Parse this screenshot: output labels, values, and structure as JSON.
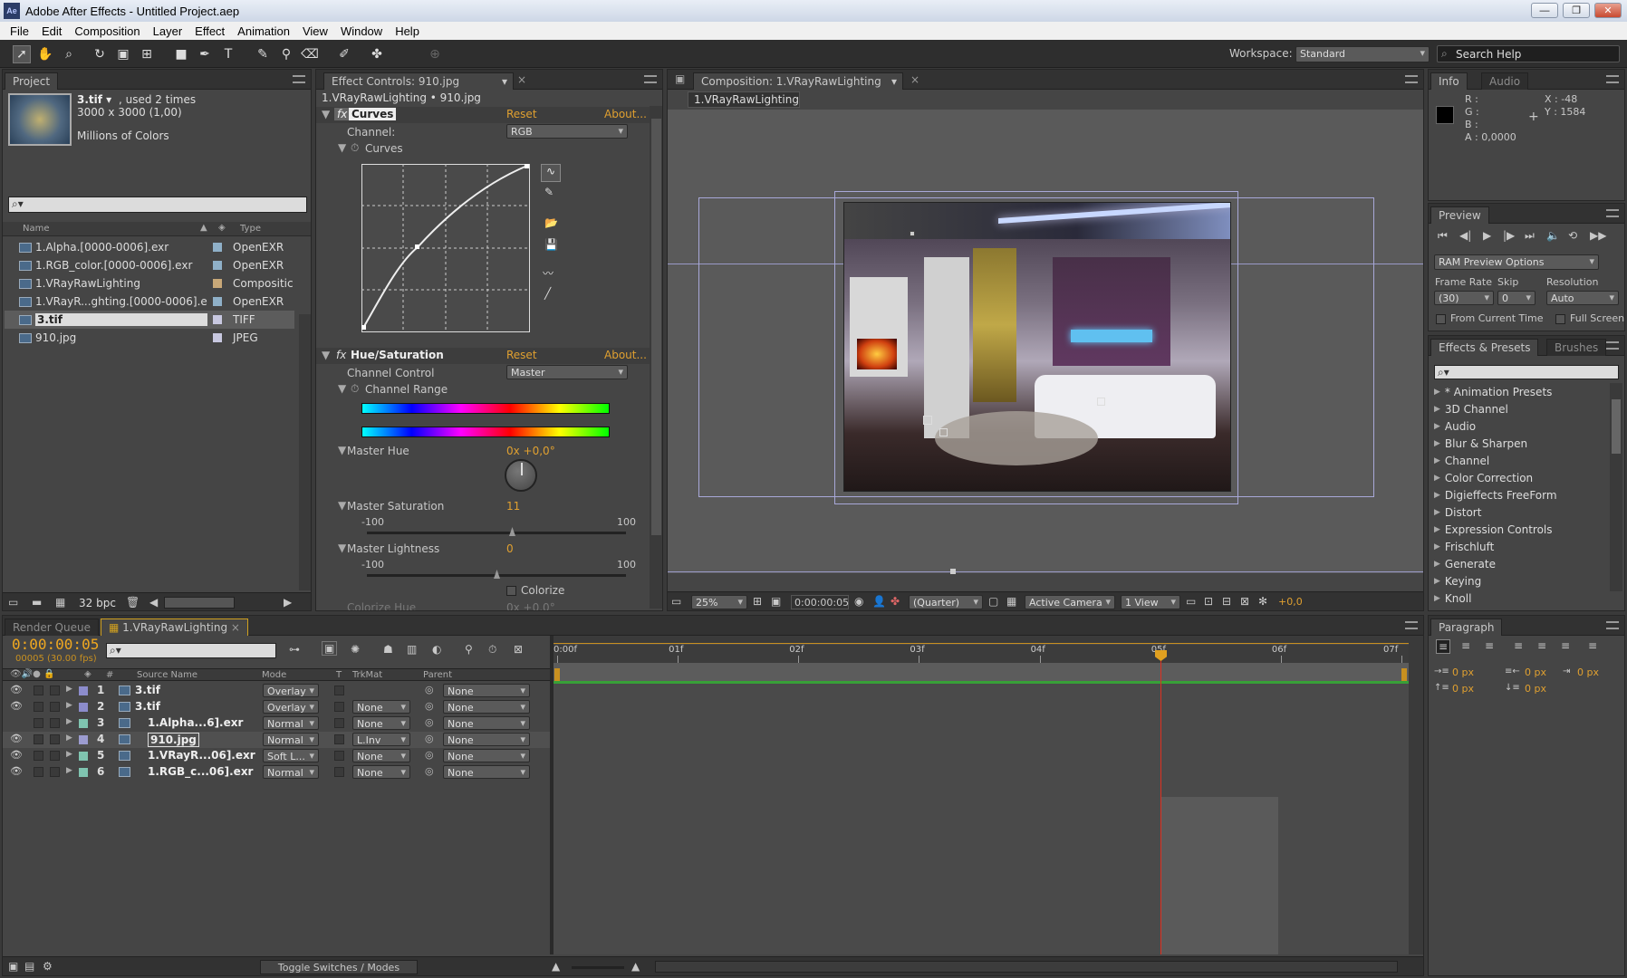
{
  "window": {
    "title": "Adobe After Effects - Untitled Project.aep",
    "icon": "Ae",
    "min": "—",
    "max": "❐",
    "close": "✕"
  },
  "menu": [
    "File",
    "Edit",
    "Composition",
    "Layer",
    "Effect",
    "Animation",
    "View",
    "Window",
    "Help"
  ],
  "toolbar": {
    "workspace_label": "Workspace:",
    "workspace_value": "Standard",
    "search_placeholder": "Search Help"
  },
  "project": {
    "tab": "Project",
    "item_name": "3.tif ▾",
    "item_used": ", used 2 times",
    "item_dims": "3000 x 3000 (1,00)",
    "item_colors": "Millions of Colors",
    "col_name": "Name",
    "col_type": "Type",
    "bpc": "32 bpc",
    "items": [
      {
        "name": "1.Alpha.[0000-0006].exr",
        "type": "OpenEXR",
        "color": "#8fb0c8"
      },
      {
        "name": "1.RGB_color.[0000-0006].exr",
        "type": "OpenEXR",
        "color": "#8fb0c8"
      },
      {
        "name": "1.VRayRawLighting",
        "type": "Compositic",
        "color": "#c8a878"
      },
      {
        "name": "1.VRayR...ghting.[0000-0006].exr",
        "type": "OpenEXR",
        "color": "#8fb0c8"
      },
      {
        "name": "3.tif",
        "type": "TIFF",
        "color": "#c8c8e0"
      },
      {
        "name": "910.jpg",
        "type": "JPEG",
        "color": "#c8c8e0"
      }
    ]
  },
  "effects": {
    "tab": "Effect Controls: 910.jpg",
    "subtitle": "1.VRayRawLighting • 910.jpg",
    "curves": {
      "name": "Curves",
      "reset": "Reset",
      "about": "About...",
      "channel_label": "Channel:",
      "channel_value": "RGB",
      "sub": "Curves"
    },
    "hue": {
      "name": "Hue/Saturation",
      "reset": "Reset",
      "about": "About...",
      "channel_control_label": "Channel Control",
      "channel_control_value": "Master",
      "channel_range": "Channel Range",
      "master_hue": "Master Hue",
      "master_hue_value": "0x +0,0°",
      "master_sat": "Master Saturation",
      "master_sat_value": "11",
      "master_sat_min": "-100",
      "master_sat_max": "100",
      "master_light": "Master Lightness",
      "master_light_value": "0",
      "master_light_min": "-100",
      "master_light_max": "100",
      "colorize": "Colorize",
      "colorize_hue": "Colorize Hue",
      "colorize_hue_value": "0x +0,0°"
    }
  },
  "comp": {
    "tab": "Composition: 1.VRayRawLighting",
    "subtab": "1.VRayRawLighting",
    "zoom": "25%",
    "timecode": "0:00:00:05",
    "resolution": "(Quarter)",
    "camera": "Active Camera",
    "view": "1 View",
    "exposure": "+0,0"
  },
  "info": {
    "tab": "Info",
    "tab2": "Audio",
    "r": "R :",
    "g": "G :",
    "b": "B :",
    "a": "A : 0,0000",
    "x": "X : -48",
    "y": "Y : 1584"
  },
  "preview": {
    "tab": "Preview",
    "ram": "RAM Preview Options",
    "frame_rate_label": "Frame Rate",
    "skip_label": "Skip",
    "resolution_label": "Resolution",
    "frame_rate": "(30)",
    "skip": "0",
    "resolution": "Auto",
    "from_current": "From Current Time",
    "full_screen": "Full Screen"
  },
  "fxpresets": {
    "tab": "Effects & Presets",
    "tab2": "Brushes",
    "items": [
      "* Animation Presets",
      "3D Channel",
      "Audio",
      "Blur & Sharpen",
      "Channel",
      "Color Correction",
      "Digieffects FreeForm",
      "Distort",
      "Expression Controls",
      "Frischluft",
      "Generate",
      "Keying",
      "Knoll"
    ]
  },
  "timeline": {
    "tab_render": "Render Queue",
    "tab_comp": "1.VRayRawLighting",
    "timecode": "0:00:00:05",
    "fps": "00005 (30.00 fps)",
    "headers": {
      "num": "#",
      "source": "Source Name",
      "mode": "Mode",
      "t": "T",
      "trkmat": "TrkMat",
      "parent": "Parent"
    },
    "ruler": [
      "0:00f",
      "01f",
      "02f",
      "03f",
      "04f",
      "05f",
      "06f",
      "07f"
    ],
    "toggle": "Toggle Switches / Modes",
    "layers": [
      {
        "num": "1",
        "name": "3.tif",
        "mode": "Overlay",
        "trkmat": "",
        "parent": "None",
        "color": "#8c8ccc",
        "bar": "#7878a8"
      },
      {
        "num": "2",
        "name": "3.tif",
        "mode": "Overlay",
        "trkmat": "None",
        "parent": "None",
        "color": "#8c8ccc",
        "bar": "#7878a8"
      },
      {
        "num": "3",
        "name": "1.Alpha...6].exr",
        "mode": "Normal",
        "trkmat": "None",
        "parent": "None",
        "color": "#7fc4b0",
        "bar": "#5f9e90"
      },
      {
        "num": "4",
        "name": "910.jpg",
        "mode": "Normal",
        "trkmat": "L.Inv",
        "parent": "None",
        "color": "#9c9cd0",
        "bar": "#a8a8c8"
      },
      {
        "num": "5",
        "name": "1.VRayR...06].exr",
        "mode": "Soft L...",
        "trkmat": "None",
        "parent": "None",
        "color": "#7fc4b0",
        "bar": "#5f9e90"
      },
      {
        "num": "6",
        "name": "1.RGB_c...06].exr",
        "mode": "Normal",
        "trkmat": "None",
        "parent": "None",
        "color": "#7fc4b0",
        "bar": "#5f9e90"
      }
    ]
  },
  "paragraph": {
    "tab": "Paragraph",
    "v1": "0 px",
    "v2": "0 px",
    "v3": "0 px",
    "v4": "0 px",
    "v5": "0 px"
  }
}
